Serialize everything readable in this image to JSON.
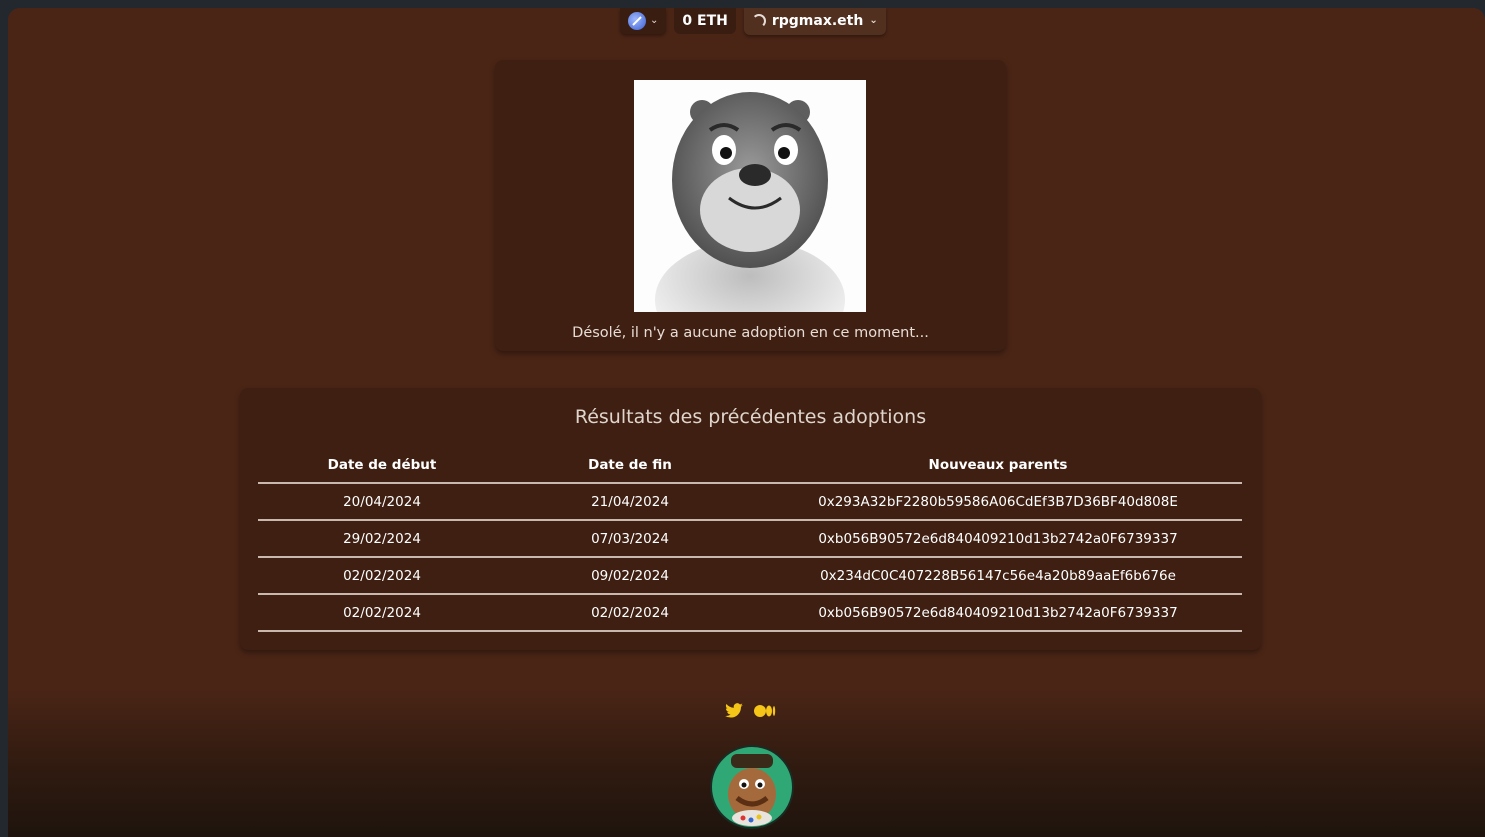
{
  "header": {
    "eth_balance": "0 ETH",
    "account_name": "rpgmax.eth"
  },
  "adoption": {
    "message": "Désolé, il n'y a aucune adoption en ce moment..."
  },
  "results": {
    "title": "Résultats des précédentes adoptions",
    "columns": [
      "Date de début",
      "Date de fin",
      "Nouveaux parents"
    ],
    "rows": [
      [
        "20/04/2024",
        "21/04/2024",
        "0x293A32bF2280b59586A06CdEf3B7D36BF40d808E"
      ],
      [
        "29/02/2024",
        "07/03/2024",
        "0xb056B90572e6d840409210d13b2742a0F6739337"
      ],
      [
        "02/02/2024",
        "09/02/2024",
        "0x234dC0C407228B56147c56e4a20b89aaEf6b676e"
      ],
      [
        "02/02/2024",
        "02/02/2024",
        "0xb056B90572e6d840409210d13b2742a0F6739337"
      ]
    ]
  },
  "footer": {
    "social_icons": [
      "twitter-icon",
      "medium-icon"
    ],
    "accent_color": "#f5c518"
  }
}
